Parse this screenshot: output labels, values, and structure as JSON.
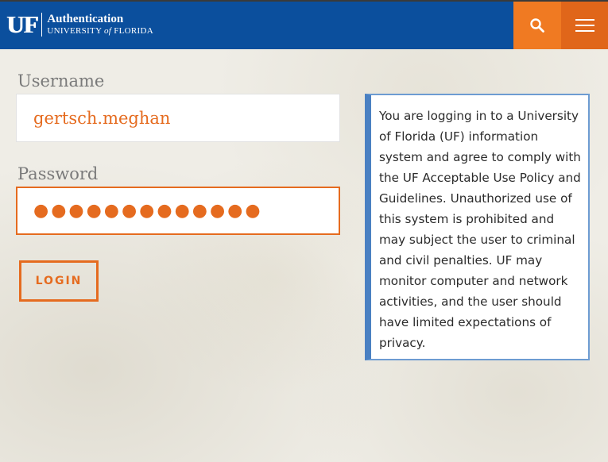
{
  "header": {
    "logo_mark": "UF",
    "title": "Authentication",
    "subtitle_part1": "UNIVERSITY",
    "subtitle_of": "of",
    "subtitle_part2": "FLORIDA",
    "search_icon": "search-icon",
    "menu_icon": "hamburger-menu-icon",
    "brand_color": "#0b4f9d",
    "accent_color": "#f07a22"
  },
  "form": {
    "username_label": "Username",
    "username_value": "gertsch.meghan",
    "password_label": "Password",
    "password_masked": "●●●●●●●●●●●●●",
    "login_label": "LOGIN"
  },
  "notice": {
    "text": "You are logging in to a University of Florida (UF) information system and agree to comply with the UF Acceptable Use Policy and Guidelines. Unauthorized use of this system is prohibited and may subject the user to criminal and civil penalties. UF may monitor computer and network activities, and the user should have limited expectations of privacy."
  }
}
